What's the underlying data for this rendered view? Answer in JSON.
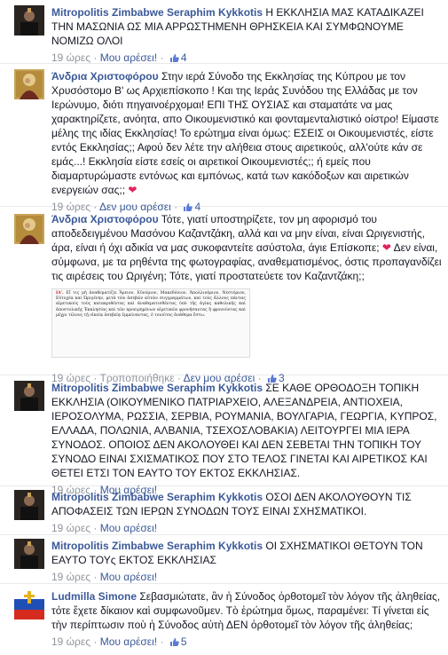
{
  "comments": [
    {
      "author": "Mitropolitis Zimbabwe Seraphim Kykkotis",
      "text": "Η ΕΚΚΛΗΣΙΑ ΜΑΣ ΚΑΤΑΔΙΚΑΖΕΙ ΤΗΝ ΜΑΣΩΝΙΑ ΩΣ ΜΙΑ ΑΡΡΩΣΤΗΜΕΝΗ ΘΡΗΣΚΕΙΑ ΚΑΙ ΣΥΜΦΩΝΟΥΜΕ ΝΟΜΙΖΩ ΟΛΟΙ",
      "time": "19 ώρες",
      "action": "Μου αρέσει!",
      "likes": "4"
    },
    {
      "author": "Άνδρια Χριστοφόρου",
      "text": "Στην ιερά Σύνοδο της Εκκλησίας της Κύπρου με τον Χρυσόστομο Β' ως Αρχιεπίσκοπο ! Και της Ιεράς Συνόδου της Ελλάδας με τον Ιερώνυμο, διότι πηγαινοέρχομαι! ΕΠΙ ΤΗΣ ΟΥΣΙΑΣ και σταματάτε να μας χαρακτηρίζετε, ανόητα, απο Οικουμενιστικό και φονταμενταλιστικό οίστρο! Είμαστε μέλης της ιδίας Εκκλησίας! Το ερώτημα είναι όμως: ΕΣΕΙΣ οι Οικουμενιστές, είστε εντός Εκκλησίας;; Αφού δεν λέτε την αλήθεια στους αιρετικούς, αλλ'ούτε κάν σε εμάς...! Εκκλησία είστε εσείς οι αιρετικοί Οικουμενιστές;; ή εμείς που διαμαρτυρώμαστε εντόνως και εμπόνως, κατά των κακόδοξων και αιρετικών ενεργειών σας;;",
      "time": "19 ώρες",
      "action": "Δεν μου αρέσει",
      "likes": "4"
    },
    {
      "author": "Άνδρια Χριστοφόρου",
      "text_a": "Τότε, γιατί υποστηρίζετε, τον μη αφορισμό του αποδεδειγμένου Μασόνου Καζαντζάκη, αλλά και να μην είναι, είναι Ωριγενιστής, άρα, είναι ή όχι αδικία να μας συκοφαντείτε ασύστολα, άγιε Επίσκοπε;",
      "text_b": "Δεν είναι, σύμφωνα, με τα ρηθέντα της φωτογραφίας, αναθεματισμένος, όστις προπαγανδίζει τις αιρέσεις του Ωριγένη; Τότε, γιατί προστατεύετε τον Καζαντζάκη;;",
      "quote_heading": "ΙΑ'.",
      "quote_text": "Εἴ τις μὴ ἀναθεματίζει Ἄρειον, Εὐνόμιον, Μακεδόνιον, Ἀπολλινάριον, Νεστόριον, Εὐτυχέα καὶ Ὠριγένην, μετὰ τῶν ἀσεβῶν αὐτῶν συγγραμμάτων, καὶ τοὺς ἄλλους πάντας αἱρετικοὺς τοὺς κατακριθέντας καὶ ἀναθεματισθέντας ὑπὸ τῆς ἁγίας καθολικῆς καὶ ἀποστολικῆς Ἐκκλησίας καὶ τῶν προειρημένων αἱρετικῶν φρονήσαντας ἢ φρονοῦντας καὶ μέχρι τέλους τῇ οἰκείᾳ ἀσεβείᾳ ἐμμείναντας, ὁ τοιοῦτος ἀνάθεμα ἔστω.",
      "time": "19 ώρες",
      "edited": "Τροποποιήθηκε",
      "action": "Δεν μου αρέσει",
      "likes": "3"
    },
    {
      "author": "Mitropolitis Zimbabwe Seraphim Kykkotis",
      "text": "ΣΕ ΚΑΘΕ ΟΡΘΟΔΟΞΗ ΤΟΠΙΚΗ ΕΚΚΛΗΣΙΑ (ΟΙΚΟΥΜΕΝΙΚΟ ΠΑΤΡΙΑΡΧΕΙΟ, ΑΛΕΞΑΝΔΡΕΙΑ, ΑΝΤΙΟΧΕΙΑ, ΙΕΡΟΣΟΛΥΜΑ, ΡΩΣΣΙΑ, ΣΕΡΒΙΑ, ΡΟΥΜΑΝΙΑ, ΒΟΥΛΓΑΡΙΑ, ΓΕΩΡΓΙΑ, ΚΥΠΡΟΣ, ΕΛΛΑΔΑ, ΠΟΛΩΝΙΑ, ΑΛΒΑΝΙΑ, ΤΣΕΧΟΣΛΟΒΑΚΙΑ) ΛΕΙΤΟΥΡΓΕΙ ΜΙΑ ΙΕΡΑ ΣΥΝΟΔΟΣ. ΟΠΟΙΟΣ ΔΕΝ ΑΚΟΛΟΥΘΕΙ ΚΑΙ ΔΕΝ ΣΕΒΕΤΑΙ ΤΗΝ ΤΟΠΙΚΗ ΤΟΥ ΣΥΝΟΔΟ ΕΙΝΑΙ ΣΧΙΣΜΑΤΙΚΟΣ ΠΟΥ ΣΤΟ ΤΕΛΟΣ ΓΙΝΕΤΑΙ ΚΑΙ ΑΙΡΕΤΙΚΟΣ ΚΑΙ ΘΕΤΕΙ ΕΤΣΙ ΤΟΝ ΕΑΥΤΟ ΤΟΥ ΕΚΤΟΣ ΕΚΚΛΗΣΙΑΣ.",
      "time": "19 ώρες",
      "action": "Μου αρέσει!"
    },
    {
      "author": "Mitropolitis Zimbabwe Seraphim Kykkotis",
      "text": "ΟΣΟΙ ΔΕΝ ΑΚΟΛΟΥΘΟΥΝ ΤΙΣ ΑΠΟΦΑΣΕΙΣ ΤΩΝ ΙΕΡΩΝ ΣΥΝΟΔΩΝ ΤΟΥΣ ΕΙΝΑΙ ΣΧΗΣΜΑΤΙΚΟΙ.",
      "time": "19 ώρες",
      "action": "Μου αρέσει!"
    },
    {
      "author": "Mitropolitis Zimbabwe Seraphim Kykkotis",
      "text": "ΟΙ ΣΧΗΣΜΑΤΙΚΟΙ ΘΕΤΟΥΝ ΤΟΝ ΕΑΥΤΟ ΤΟΥς ΕΚΤΟΣ ΕΚΚΛΗΣΙΑΣ",
      "time": "19 ώρες",
      "action": "Μου αρέσει!"
    },
    {
      "author": "Ludmilla Simone",
      "text": "Σεβασμιώτατε, ἂν ἡ Σύνοδος ὀρθοτομεῖ τὸν λόγον τῆς ἀληθείας, τότε ἔχετε δίκαιον καὶ συμφωνοῦμεν. Τὸ ἐρώτημα ὅμως, παραμένει: Τί γίνεται εἰς τὴν περίπτωσιν ποὺ ἡ Σύνοδος αὐτὴ ΔΕΝ ὀρθοτομεῖ τὸν λόγον τῆς ἀληθείας;",
      "time": "19 ώρες",
      "action": "Μου αρέσει!",
      "likes": "5"
    }
  ],
  "colors": {
    "link": "#3b5998",
    "meta": "#90949c",
    "text": "#141823",
    "heart": "#e0245e"
  }
}
